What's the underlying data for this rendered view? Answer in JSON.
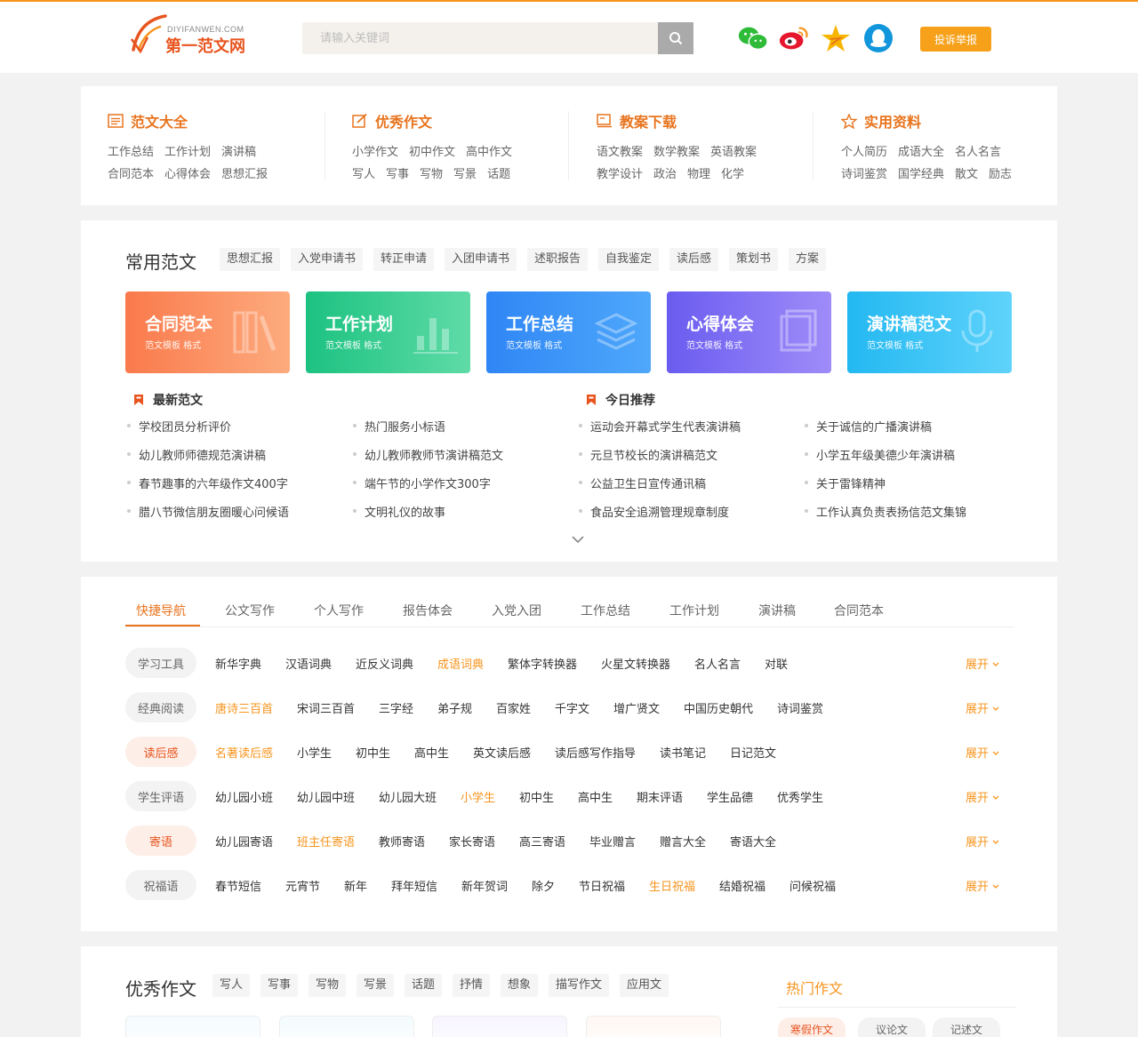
{
  "header": {
    "logo_en": "DIYIFANWEN.COM",
    "logo_cn": "第一范文网",
    "search_placeholder": "请输入关键词",
    "report_label": "投诉举报"
  },
  "categories": [
    {
      "title": "范文大全",
      "icon": "list-icon",
      "rows": [
        [
          "工作总结",
          "工作计划",
          "演讲稿"
        ],
        [
          "合同范本",
          "心得体会",
          "思想汇报"
        ]
      ]
    },
    {
      "title": "优秀作文",
      "icon": "edit-icon",
      "rows": [
        [
          "小学作文",
          "初中作文",
          "高中作文"
        ],
        [
          "写人",
          "写事",
          "写物",
          "写景",
          "话题"
        ]
      ]
    },
    {
      "title": "教案下载",
      "icon": "monitor-icon",
      "rows": [
        [
          "语文教案",
          "数学教案",
          "英语教案"
        ],
        [
          "教学设计",
          "政治",
          "物理",
          "化学"
        ]
      ]
    },
    {
      "title": "实用资料",
      "icon": "star-icon",
      "rows": [
        [
          "个人简历",
          "成语大全",
          "名人名言"
        ],
        [
          "诗词鉴赏",
          "国学经典",
          "散文",
          "励志"
        ]
      ]
    }
  ],
  "common": {
    "title": "常用范文",
    "tags": [
      "思想汇报",
      "入党申请书",
      "转正申请",
      "入团申请书",
      "述职报告",
      "自我鉴定",
      "读后感",
      "策划书",
      "方案"
    ],
    "banners": [
      {
        "title": "合同范本",
        "sub": "范文模板 格式",
        "c1": "#fa7a4c",
        "c2": "#fdab7e"
      },
      {
        "title": "工作计划",
        "sub": "范文模板 格式",
        "c1": "#1cc281",
        "c2": "#5fdba7"
      },
      {
        "title": "工作总结",
        "sub": "范文模板 格式",
        "c1": "#2f86f5",
        "c2": "#4fa8fb"
      },
      {
        "title": "心得体会",
        "sub": "范文模板 格式",
        "c1": "#6a5cf0",
        "c2": "#9f8cf9"
      },
      {
        "title": "演讲稿范文",
        "sub": "范文模板 格式",
        "c1": "#23b8f1",
        "c2": "#5fd3fb"
      }
    ],
    "latest_title": "最新范文",
    "latest": [
      [
        "学校团员分析评价",
        "热门服务小标语"
      ],
      [
        "幼儿教师师德规范演讲稿",
        "幼儿教师教师节演讲稿范文"
      ],
      [
        "春节趣事的六年级作文400字",
        "端午节的小学作文300字"
      ],
      [
        "腊八节微信朋友圈暖心问候语",
        "文明礼仪的故事"
      ]
    ],
    "today_title": "今日推荐",
    "today": [
      [
        "运动会开幕式学生代表演讲稿",
        "关于诚信的广播演讲稿"
      ],
      [
        "元旦节校长的演讲稿范文",
        "小学五年级美德少年演讲稿"
      ],
      [
        "公益卫生日宣传通讯稿",
        "关于雷锋精神"
      ],
      [
        "食品安全追溯管理规章制度",
        "工作认真负责表扬信范文集锦"
      ]
    ]
  },
  "quicknav": {
    "tabs": [
      "快捷导航",
      "公文写作",
      "个人写作",
      "报告体会",
      "入党入团",
      "工作总结",
      "工作计划",
      "演讲稿",
      "合同范本"
    ],
    "expand_label": "展开",
    "rows": [
      {
        "label": "学习工具",
        "hot": false,
        "items": [
          "新华字典",
          "汉语词典",
          "近反义词典",
          "成语词典",
          "繁体字转换器",
          "火星文转换器",
          "名人名言",
          "对联"
        ],
        "hl": 3
      },
      {
        "label": "经典阅读",
        "hot": false,
        "items": [
          "唐诗三百首",
          "宋词三百首",
          "三字经",
          "弟子规",
          "百家姓",
          "千字文",
          "增广贤文",
          "中国历史朝代",
          "诗词鉴赏"
        ],
        "hl": 0
      },
      {
        "label": "读后感",
        "hot": true,
        "items": [
          "名著读后感",
          "小学生",
          "初中生",
          "高中生",
          "英文读后感",
          "读后感写作指导",
          "读书笔记",
          "日记范文"
        ],
        "hl": 0
      },
      {
        "label": "学生评语",
        "hot": false,
        "items": [
          "幼儿园小班",
          "幼儿园中班",
          "幼儿园大班",
          "小学生",
          "初中生",
          "高中生",
          "期末评语",
          "学生品德",
          "优秀学生"
        ],
        "hl": 3
      },
      {
        "label": "寄语",
        "hot": true,
        "items": [
          "幼儿园寄语",
          "班主任寄语",
          "教师寄语",
          "家长寄语",
          "高三寄语",
          "毕业赠言",
          "赠言大全",
          "寄语大全"
        ],
        "hl": 1
      },
      {
        "label": "祝福语",
        "hot": false,
        "items": [
          "春节短信",
          "元宵节",
          "新年",
          "拜年短信",
          "新年贺词",
          "除夕",
          "节日祝福",
          "生日祝福",
          "结婚祝福",
          "问候祝福"
        ],
        "hl": 7
      }
    ]
  },
  "essays": {
    "title": "优秀作文",
    "tags": [
      "写人",
      "写事",
      "写物",
      "写景",
      "话题",
      "抒情",
      "想象",
      "描写作文",
      "应用文"
    ],
    "hot_title": "热门作文",
    "hot_tabs": [
      "寒假作文",
      "议论文",
      "记述文"
    ]
  }
}
